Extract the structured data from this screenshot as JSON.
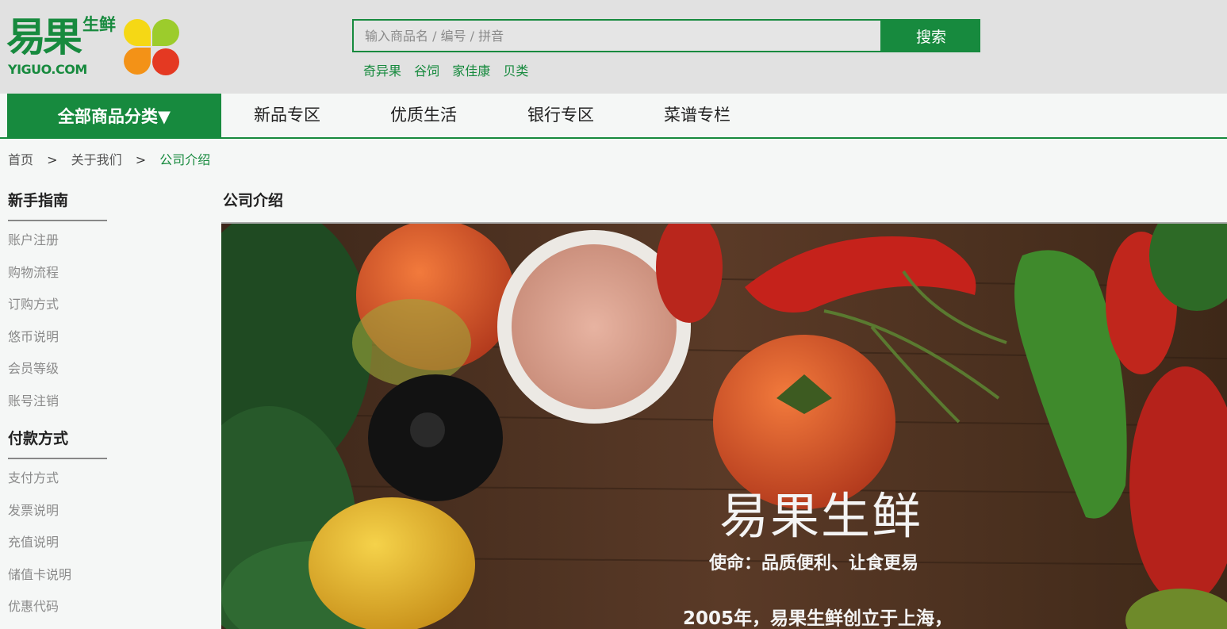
{
  "logo": {
    "cn": "易果",
    "cn_sub": "生鲜",
    "en": "YIGUO.COM",
    "colors": [
      "#f5d815",
      "#9ccc2c",
      "#f39217",
      "#e43922"
    ]
  },
  "search": {
    "placeholder": "输入商品名 / 编号 / 拼音",
    "button": "搜索"
  },
  "hot_keywords": [
    "奇异果",
    "谷饲",
    "家佳康",
    "贝类"
  ],
  "nav": {
    "category": "全部商品分类▼",
    "items": [
      "新品专区",
      "优质生活",
      "银行专区",
      "菜谱专栏"
    ]
  },
  "breadcrumb": {
    "home": "首页",
    "sep": ">",
    "level2": "关于我们",
    "current": "公司介绍"
  },
  "sidebar": {
    "groups": [
      {
        "title": "新手指南",
        "items": [
          "账户注册",
          "购物流程",
          "订购方式",
          "悠币说明",
          "会员等级",
          "账号注销"
        ]
      },
      {
        "title": "付款方式",
        "items": [
          "支付方式",
          "发票说明",
          "充值说明",
          "储值卡说明",
          "优惠代码"
        ]
      }
    ]
  },
  "content": {
    "title": "公司介绍",
    "banner": {
      "title": "易果生鲜",
      "subtitle": "使命：品质便利、让食更易",
      "text": "2005年，易果生鲜创立于上海，"
    }
  },
  "colors": {
    "brand_green": "#178a3e",
    "header_bg": "#e1e1e1",
    "page_bg": "#f5f7f6"
  }
}
